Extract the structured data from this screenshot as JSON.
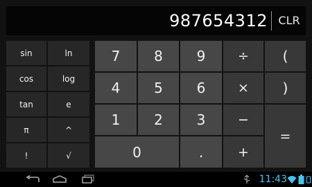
{
  "display": {
    "value": "987654312",
    "clear_label": "CLR"
  },
  "scientific_keys": [
    [
      "sin",
      "ln"
    ],
    [
      "cos",
      "log"
    ],
    [
      "tan",
      "e"
    ],
    [
      "π",
      "^"
    ],
    [
      "!",
      "√"
    ]
  ],
  "number_keys": {
    "row1": [
      "7",
      "8",
      "9"
    ],
    "row2": [
      "4",
      "5",
      "6"
    ],
    "row3": [
      "1",
      "2",
      "3"
    ],
    "zero": "0",
    "dot": "."
  },
  "operator_keys": {
    "divide": "÷",
    "multiply": "×",
    "minus": "−",
    "plus": "+",
    "equals": "=",
    "open_paren": "(",
    "close_paren": ")"
  },
  "status_bar": {
    "time": "11:43",
    "icons": [
      "back-icon",
      "home-icon",
      "recent-apps-icon",
      "usb-debug-icon",
      "sim-icon",
      "wifi-icon",
      "battery-icon"
    ]
  },
  "colors": {
    "accent": "#44c4ee",
    "cursor": "#3db6e6"
  }
}
